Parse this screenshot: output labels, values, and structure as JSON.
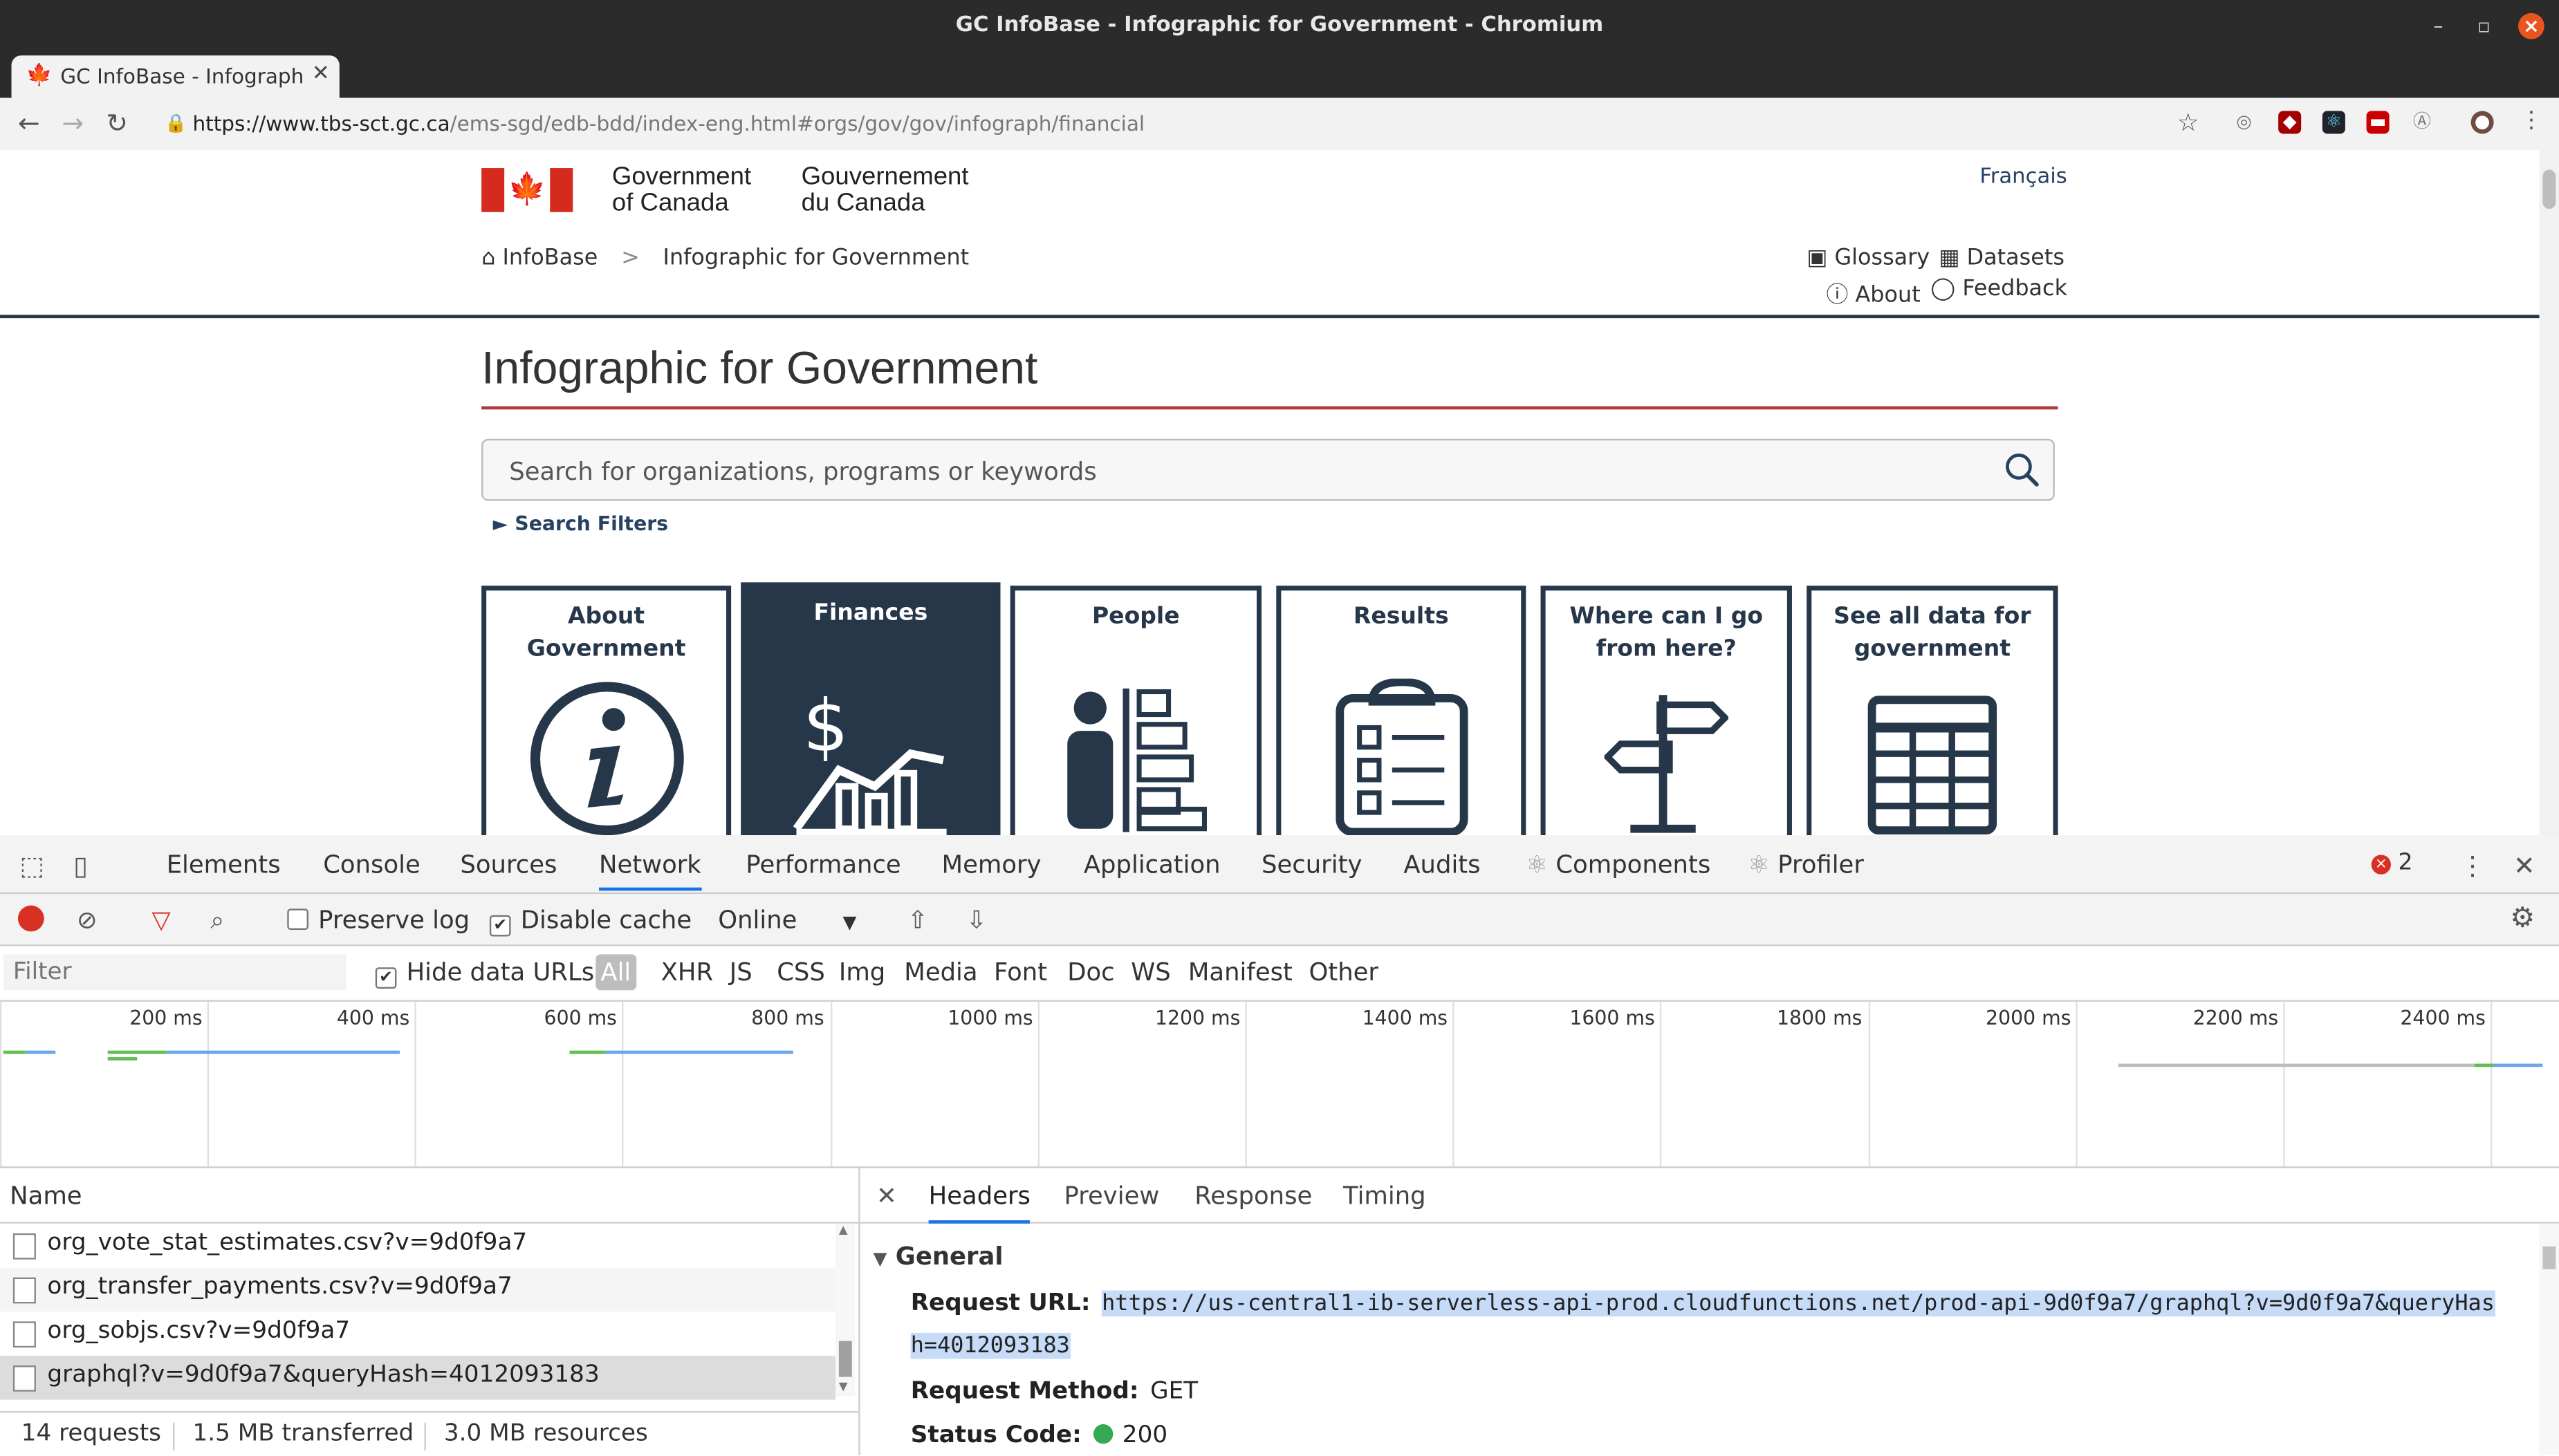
{
  "window": {
    "title": "GC InfoBase - Infographic for Government - Chromium"
  },
  "tab": {
    "title": "GC InfoBase - Infographic"
  },
  "address": {
    "host": "https://www.tbs-sct.gc.ca",
    "path": "/ems-sgd/edb-bdd/index-eng.html#orgs/gov/gov/infograph/financial"
  },
  "site": {
    "sig_en": [
      "Government",
      "of Canada"
    ],
    "sig_fr": [
      "Gouvernement",
      "du Canada"
    ],
    "language_link": "Français",
    "breadcrumb": {
      "home": "InfoBase",
      "separator": ">",
      "current": "Infographic for Government"
    },
    "links": {
      "glossary": "Glossary",
      "datasets": "Datasets",
      "about": "About",
      "feedback": "Feedback"
    }
  },
  "main": {
    "title": "Infographic for Government",
    "search_placeholder": "Search for organizations, programs or keywords",
    "search_filters": "Search Filters",
    "cards": [
      {
        "label": "About Government",
        "icon": "info-icon"
      },
      {
        "label": "Finances",
        "icon": "dollar-chart-icon",
        "active": true
      },
      {
        "label": "People",
        "icon": "people-chart-icon"
      },
      {
        "label": "Results",
        "icon": "clipboard-icon"
      },
      {
        "label": "Where can I go from here?",
        "icon": "signpost-icon"
      },
      {
        "label": "See all data for government",
        "icon": "table-icon"
      }
    ]
  },
  "devtools": {
    "tabs": [
      "Elements",
      "Console",
      "Sources",
      "Network",
      "Performance",
      "Memory",
      "Application",
      "Security",
      "Audits",
      "Components",
      "Profiler"
    ],
    "selected_tab": "Network",
    "error_count": "2",
    "controls": {
      "preserve_log": "Preserve log",
      "disable_cache": "Disable cache",
      "throttling": "Online"
    },
    "filter_placeholder": "Filter",
    "hide_data_urls": "Hide data URLs",
    "type_filters": [
      "All",
      "XHR",
      "JS",
      "CSS",
      "Img",
      "Media",
      "Font",
      "Doc",
      "WS",
      "Manifest",
      "Other"
    ],
    "timeline_ticks": [
      "200 ms",
      "400 ms",
      "600 ms",
      "800 ms",
      "1000 ms",
      "1200 ms",
      "1400 ms",
      "1600 ms",
      "1800 ms",
      "2000 ms",
      "2200 ms",
      "2400 ms"
    ],
    "name_header": "Name",
    "requests": [
      "org_vote_stat_estimates.csv?v=9d0f9a7",
      "org_transfer_payments.csv?v=9d0f9a7",
      "org_sobjs.csv?v=9d0f9a7",
      "graphql?v=9d0f9a7&queryHash=4012093183"
    ],
    "status": {
      "requests": "14 requests",
      "transferred": "1.5 MB transferred",
      "resources": "3.0 MB resources"
    },
    "detail_tabs": [
      "Headers",
      "Preview",
      "Response",
      "Timing"
    ],
    "general": {
      "title": "General",
      "request_url_label": "Request URL:",
      "request_url_line1": "https://us-central1-ib-serverless-api-prod.cloudfunctions.net/prod-api-9d0f9a7/graphql?v=9d0f9a7&queryHas",
      "request_url_line2": "h=4012093183",
      "method_label": "Request Method:",
      "method": "GET",
      "status_label": "Status Code:",
      "status": "200"
    }
  }
}
